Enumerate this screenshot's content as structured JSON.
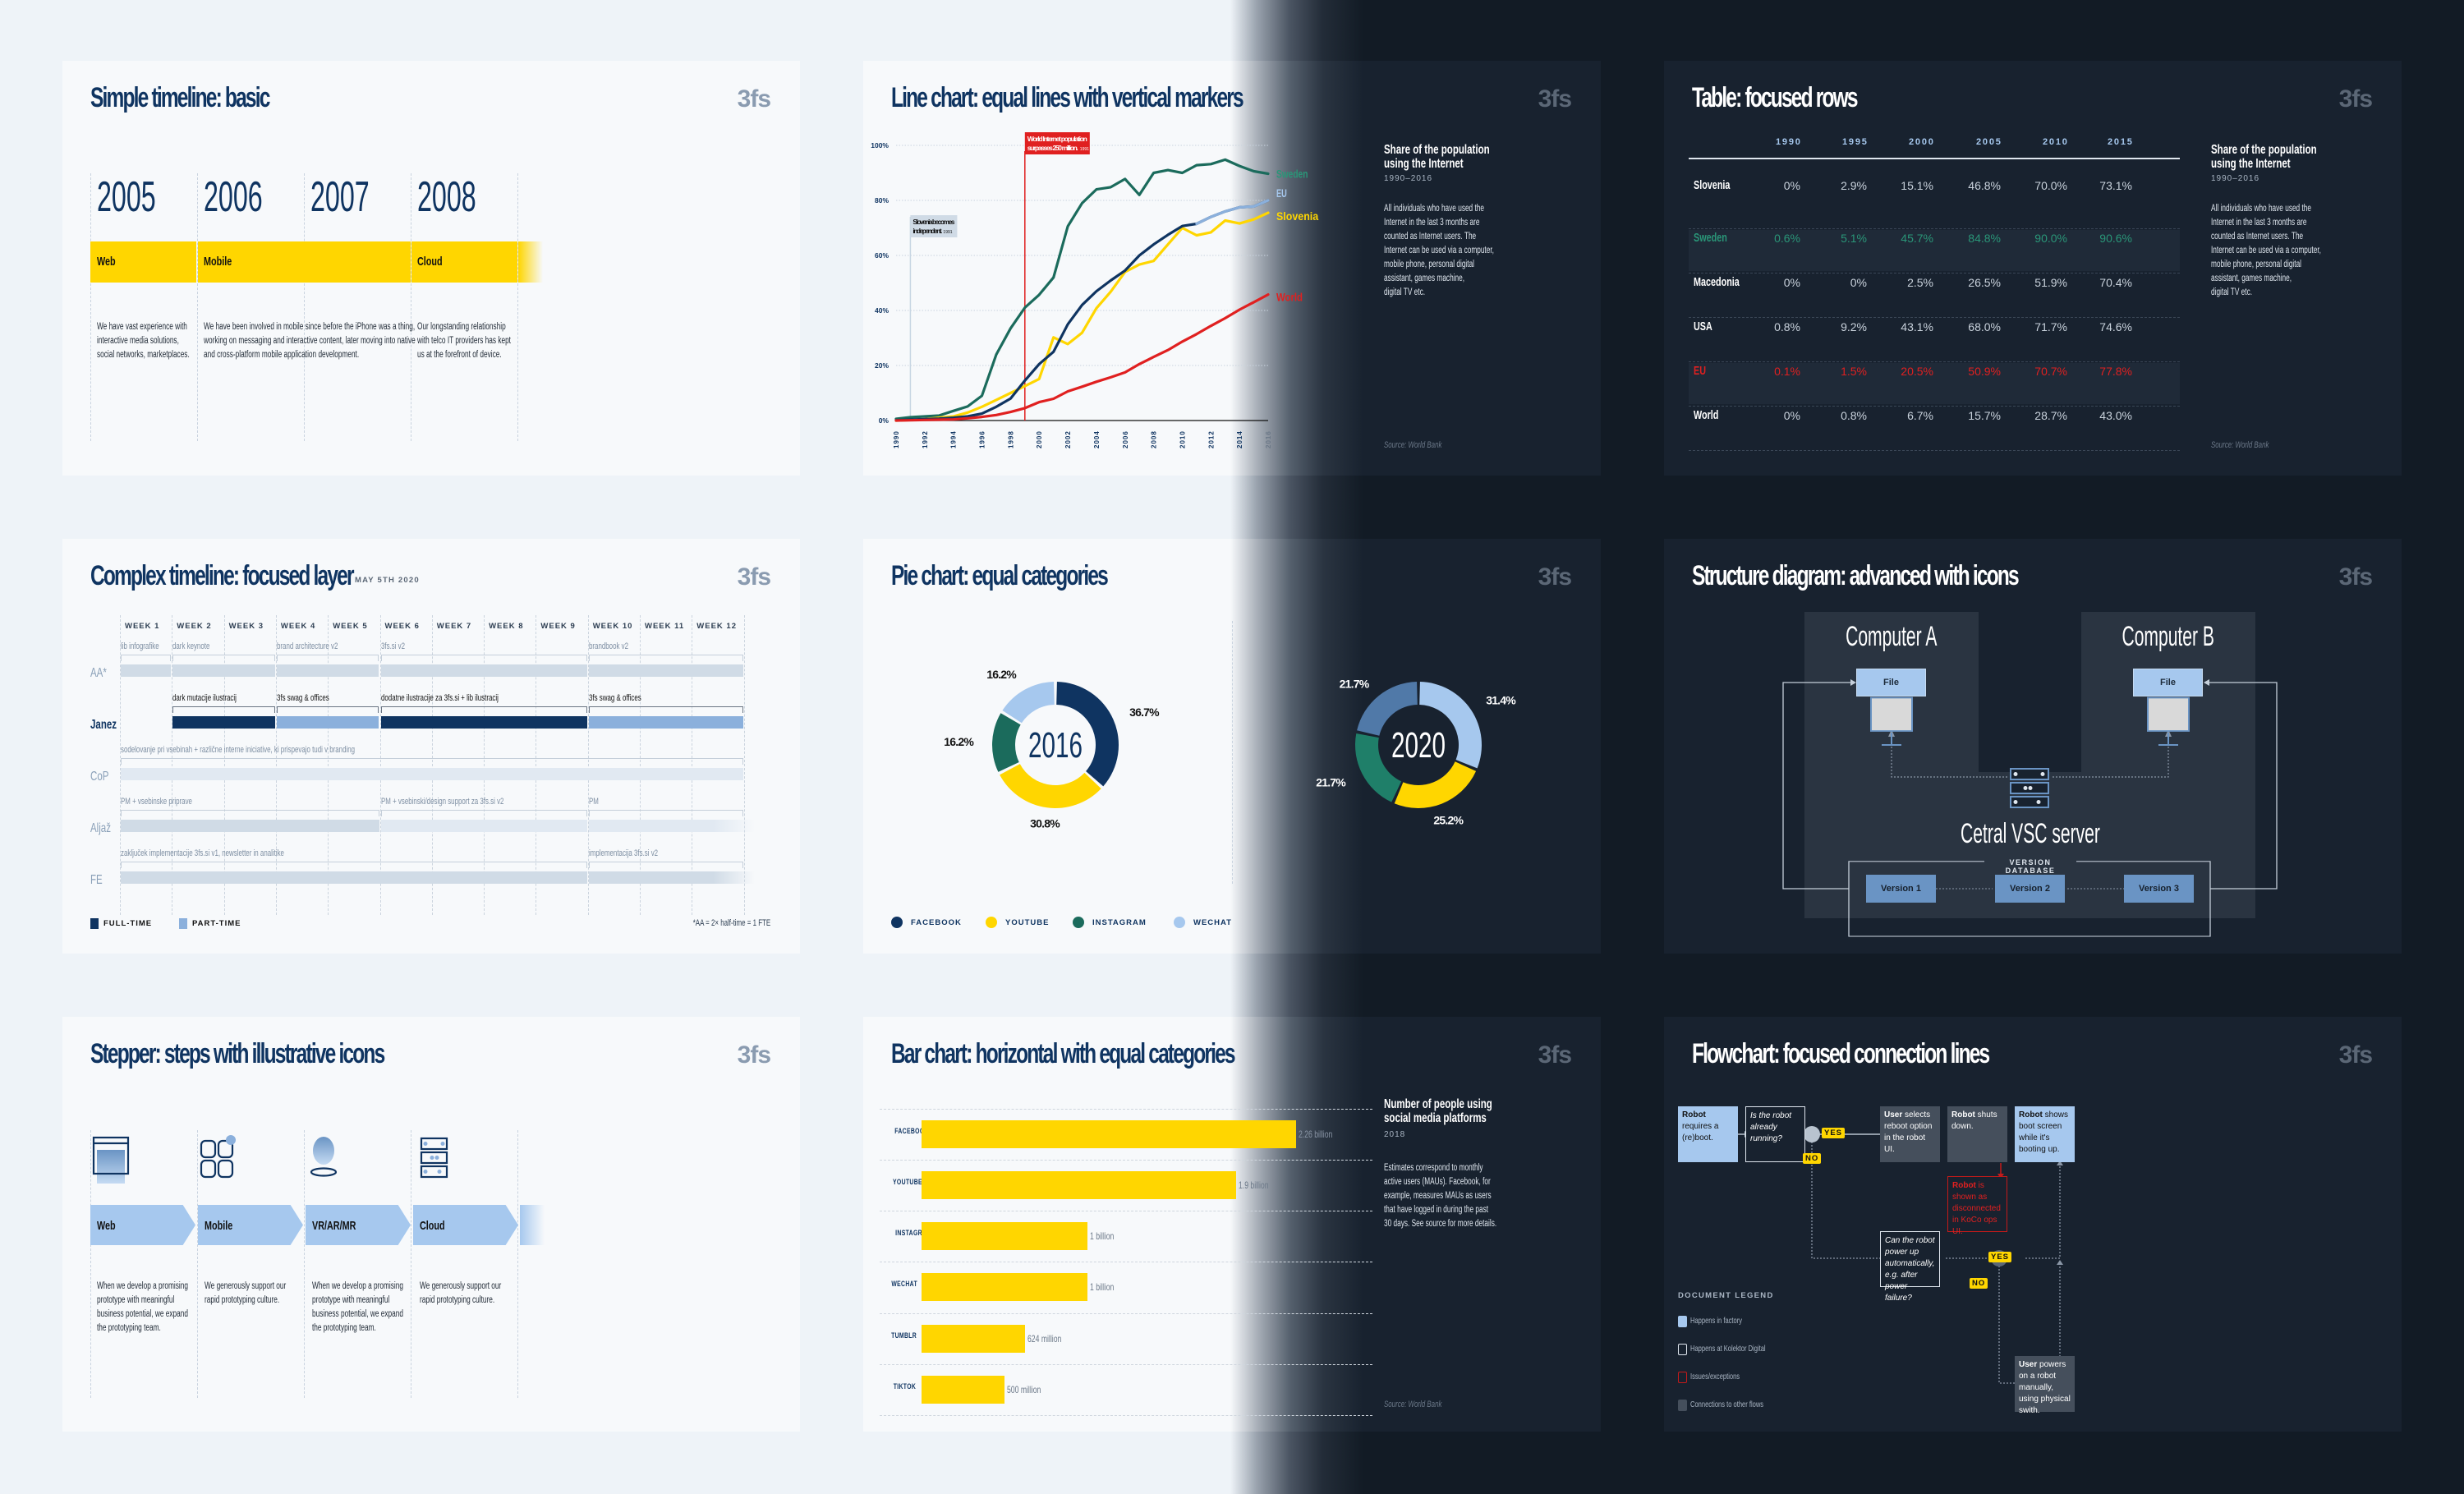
{
  "brand": "3fs",
  "colors": {
    "navy": "#0f3461",
    "yellow": "#ffd600",
    "light_blue": "#a6c8ee",
    "green": "#1b6b5c",
    "sweden_green": "#2a9678",
    "red": "#e02020",
    "steel_blue": "#5079a8",
    "dark_bg": "#121b25",
    "dark_card": "#18222f",
    "light_bg": "#eef3f8",
    "light_card": "#f7f9fb"
  },
  "simple_timeline": {
    "title": "Simple timeline: basic",
    "years": [
      "2005",
      "2006",
      "2007",
      "2008"
    ],
    "phases": [
      {
        "label": "Web",
        "desc": [
          "We have vast experience with",
          "interactive media solutions,",
          "social networks, marketplaces."
        ]
      },
      {
        "label": "Mobile",
        "desc": [
          "We have been involved in mobile since before the iPhone was a thing,",
          "working on messaging and interactive content, later moving into native",
          "and cross-platform mobile application development."
        ]
      },
      {
        "label": "Cloud",
        "desc": [
          "Our longstanding relationship",
          "with telco IT providers has kept",
          "us at the forefront of device."
        ]
      }
    ]
  },
  "line_chart": {
    "title": "Line chart: equal lines with vertical markers",
    "side_title": "Share of the population using the Internet",
    "side_title_lines": [
      "Share of the population",
      "using the Internet"
    ],
    "side_sub": "1990–2016",
    "side_desc": [
      "All individuals who have used the",
      "Internet in the last 3 months are",
      "counted as Internet users. The",
      "Internet can be used via a computer,",
      "mobile phone, personal digital",
      "assistant, games machine,",
      "digital TV etc."
    ],
    "source": "Source: World Bank",
    "annotations": [
      {
        "text_lines": [
          "Slovenia becomes",
          "independent."
        ],
        "year_tag": "1991",
        "x": 1991,
        "style": "light"
      },
      {
        "text_lines": [
          "World Internet population",
          "surpasses 250 million."
        ],
        "year_tag": "1991",
        "x": 1999,
        "style": "red"
      }
    ]
  },
  "chart_data": [
    {
      "type": "line",
      "title": "Share of the population using the Internet",
      "subtitle": "1990–2016",
      "xlabel": "",
      "ylabel": "",
      "x": [
        1990,
        1991,
        1992,
        1993,
        1994,
        1995,
        1996,
        1997,
        1998,
        1999,
        2000,
        2001,
        2002,
        2003,
        2004,
        2005,
        2006,
        2007,
        2008,
        2009,
        2010,
        2011,
        2012,
        2013,
        2014,
        2015,
        2016
      ],
      "x_ticks": [
        "1990",
        "1992",
        "1994",
        "1996",
        "1998",
        "2000",
        "2002",
        "2004",
        "2006",
        "2008",
        "2010",
        "2012",
        "2014",
        "2016"
      ],
      "y_ticks": [
        "0%",
        "20%",
        "40%",
        "60%",
        "80%",
        "100%"
      ],
      "ylim": [
        0,
        100
      ],
      "grid": true,
      "legend": "end-of-line labels",
      "series": [
        {
          "name": "Sweden",
          "color": "#1b6b5c",
          "label_color": "#2a9678",
          "values": [
            0.6,
            1.2,
            1.5,
            1.8,
            3.5,
            5.1,
            9,
            24,
            33.5,
            41,
            45.7,
            52,
            70.6,
            79,
            84,
            84.8,
            87.8,
            82,
            90,
            91,
            90,
            92.8,
            93.2,
            94.8,
            92.5,
            90.6,
            89.7
          ]
        },
        {
          "name": "EU",
          "color": "#0f3461",
          "label_color": "#a6c8ee",
          "values": [
            0.1,
            0.3,
            0.5,
            0.7,
            1,
            1.5,
            2.5,
            5,
            8,
            14.5,
            20.5,
            25,
            35,
            42,
            47,
            50.9,
            54.5,
            60,
            64,
            67.5,
            70.7,
            71.5,
            74,
            76,
            77.5,
            77.8,
            80
          ]
        },
        {
          "name": "Slovenia",
          "color": "#ffd600",
          "label_color": "#ffd600",
          "values": [
            0,
            0.2,
            0.5,
            1,
            1.5,
            2.9,
            5,
            7.5,
            10,
            12.5,
            15.1,
            30.2,
            27.8,
            31.9,
            40.8,
            46.8,
            54,
            56.7,
            58,
            64,
            70,
            67.3,
            68.4,
            72.7,
            71.6,
            73.1,
            75.5
          ]
        },
        {
          "name": "World",
          "color": "#e02020",
          "label_color": "#e02020",
          "values": [
            0,
            0.1,
            0.2,
            0.3,
            0.4,
            0.8,
            1.3,
            2,
            3.1,
            4.5,
            6.7,
            7.9,
            10.6,
            12.3,
            14.1,
            15.7,
            17.5,
            20.5,
            23.1,
            25.6,
            28.7,
            31.4,
            34.4,
            37.2,
            40.3,
            43,
            45.8
          ]
        }
      ]
    },
    {
      "type": "table",
      "title": "Share of the population using the Internet",
      "columns": [
        "",
        "1990",
        "1995",
        "2000",
        "2005",
        "2010",
        "2015"
      ],
      "rows": [
        {
          "name": "Slovenia",
          "values": [
            "0%",
            "2.9%",
            "15.1%",
            "46.8%",
            "70.0%",
            "73.1%"
          ],
          "style": "normal"
        },
        {
          "name": "Sweden",
          "values": [
            "0.6%",
            "5.1%",
            "45.7%",
            "84.8%",
            "90.0%",
            "90.6%"
          ],
          "style": "sweden"
        },
        {
          "name": "Macedonia",
          "values": [
            "0%",
            "0%",
            "2.5%",
            "26.5%",
            "51.9%",
            "70.4%"
          ],
          "style": "normal"
        },
        {
          "name": "USA",
          "values": [
            "0.8%",
            "9.2%",
            "43.1%",
            "68.0%",
            "71.7%",
            "74.6%"
          ],
          "style": "normal"
        },
        {
          "name": "EU",
          "values": [
            "0.1%",
            "1.5%",
            "20.5%",
            "50.9%",
            "70.7%",
            "77.8%"
          ],
          "style": "eu"
        },
        {
          "name": "World",
          "values": [
            "0%",
            "0.8%",
            "6.7%",
            "15.7%",
            "28.7%",
            "43.0%"
          ],
          "style": "normal"
        }
      ]
    },
    {
      "type": "pie",
      "title": "2016",
      "categories": [
        "Facebook",
        "YouTube",
        "Instagram",
        "WeChat"
      ],
      "values": [
        36.7,
        30.8,
        16.2,
        16.2
      ],
      "labels": [
        "36.7%",
        "30.8%",
        "16.2%",
        "16.2%"
      ],
      "colors": [
        "#0f3461",
        "#ffd600",
        "#1b6b5c",
        "#a6c8ee"
      ]
    },
    {
      "type": "pie",
      "title": "2020",
      "categories": [
        "WeChat",
        "YouTube",
        "Instagram",
        "Facebook"
      ],
      "values": [
        31.4,
        25.2,
        21.7,
        21.7
      ],
      "labels": [
        "31.4%",
        "25.2%",
        "21.7%",
        "21.7%"
      ],
      "colors": [
        "#a6c8ee",
        "#ffd600",
        "#1f7f69",
        "#5079a8"
      ]
    },
    {
      "type": "bar",
      "orientation": "horizontal",
      "title": "Number of people using social media platforms",
      "subtitle": "2018",
      "categories": [
        "FACEBOOK",
        "YOUTUBE",
        "INSTAGRAM",
        "WECHAT",
        "TUMBLR",
        "TIKTOK"
      ],
      "values": [
        2260,
        1900,
        1000,
        1000,
        624,
        500
      ],
      "unit": "million",
      "value_labels": [
        "2.26 billion",
        "1.9 billion",
        "1 billion",
        "1 billion",
        "624 million",
        "500 million"
      ],
      "xlim": [
        0,
        2260
      ],
      "grid": true
    }
  ],
  "table": {
    "title": "Table: focused rows",
    "side_title_lines": [
      "Share of the population",
      "using the Internet"
    ],
    "side_sub": "1990–2016",
    "side_desc": [
      "All individuals who have used the",
      "Internet in the last 3 months are",
      "counted as Internet users. The",
      "Internet can be used via a computer,",
      "mobile phone, personal digital",
      "assistant, games machine,",
      "digital TV etc."
    ],
    "source": "Source: World Bank"
  },
  "complex_timeline": {
    "title": "Complex timeline: focused layer",
    "date": "MAY 5TH 2020",
    "weeks": [
      "WEEK 1",
      "WEEK 2",
      "WEEK 3",
      "WEEK 4",
      "WEEK 5",
      "WEEK 6",
      "WEEK 7",
      "WEEK 8",
      "WEEK 9",
      "WEEK 10",
      "WEEK 11",
      "WEEK 12"
    ],
    "rows": [
      {
        "person": "AA*",
        "focus": false,
        "tasks": [
          {
            "label": "lib infografike",
            "start": 1,
            "end": 1,
            "type": "part"
          },
          {
            "label": "dark keynote",
            "start": 2,
            "end": 3,
            "type": "part"
          },
          {
            "label": "brand architecture v2",
            "start": 4,
            "end": 5,
            "type": "part"
          },
          {
            "label": "3fs.si v2",
            "start": 6,
            "end": 9,
            "type": "part"
          },
          {
            "label": "brandbook v2",
            "start": 10,
            "end": 12,
            "type": "part"
          }
        ]
      },
      {
        "person": "Janez",
        "focus": true,
        "tasks": [
          {
            "label": "dark mutacije ilustracij",
            "start": 2,
            "end": 3,
            "type": "full"
          },
          {
            "label": "3fs swag & offices",
            "start": 4,
            "end": 5,
            "type": "part"
          },
          {
            "label": "dodatne ilustracije za 3fs.si + lib ilustracij",
            "start": 6,
            "end": 9,
            "type": "full"
          },
          {
            "label": "3fs swag & offices",
            "start": 10,
            "end": 12,
            "type": "part"
          }
        ]
      },
      {
        "person": "CoP",
        "focus": false,
        "tasks": [
          {
            "label": "sodelovanje pri vsebinah + različne interne iniciative, ki prispevajo tudi v branding",
            "start": 1,
            "end": 12,
            "type": "light"
          }
        ]
      },
      {
        "person": "Aljaž",
        "focus": false,
        "tasks": [
          {
            "label": "PM + vsebinske priprave",
            "start": 1,
            "end": 5,
            "type": "part"
          },
          {
            "label": "PM + vsebinski/design support za 3fs.si v2",
            "start": 6,
            "end": 9,
            "type": "light"
          },
          {
            "label": "PM",
            "start": 10,
            "end": 12,
            "type": "light"
          }
        ]
      },
      {
        "person": "FE",
        "focus": false,
        "tasks": [
          {
            "label": "zaključek implementacije 3fs.si v1, newsletter in analitike",
            "start": 1,
            "end": 9,
            "type": "part"
          },
          {
            "label": "implementacija 3fs.si v2",
            "start": 10,
            "end": 12,
            "type": "part"
          }
        ]
      }
    ],
    "legend": [
      {
        "label": "FULL-TIME",
        "color": "#0f3461"
      },
      {
        "label": "PART-TIME",
        "color": "#8bb0dc"
      }
    ],
    "footnote": "*AA = 2× half-time = 1 FTE"
  },
  "pie": {
    "title": "Pie chart: equal categories",
    "legend": [
      {
        "label": "FACEBOOK",
        "color": "#0f3461"
      },
      {
        "label": "YOUTUBE",
        "color": "#ffd600"
      },
      {
        "label": "INSTAGRAM",
        "color": "#1b6b5c"
      },
      {
        "label": "WECHAT",
        "color": "#a6c8ee"
      }
    ]
  },
  "structure": {
    "title": "Structure diagram: advanced with icons",
    "computer_a": "Computer A",
    "computer_b": "Computer B",
    "file_label": "File",
    "server": "Cetral VSC server",
    "database": "VERSION DATABASE",
    "versions": [
      "Version 1",
      "Version 2",
      "Version 3"
    ]
  },
  "stepper": {
    "title": "Stepper: steps with illustrative icons",
    "steps": [
      {
        "label": "Web",
        "icon": "browser-window-icon",
        "desc": [
          "When we develop a promising",
          "prototype with meaningful",
          "business potential, we expand",
          "the prototyping team."
        ]
      },
      {
        "label": "Mobile",
        "icon": "app-grid-icon",
        "desc": [
          "We generously support our",
          "rapid prototyping culture."
        ]
      },
      {
        "label": "VR/AR/MR",
        "icon": "hologram-icon",
        "desc": [
          "When we develop a promising",
          "prototype with meaningful",
          "business potential, we expand",
          "the prototyping team."
        ]
      },
      {
        "label": "Cloud",
        "icon": "server-stack-icon",
        "desc": [
          "We generously support our",
          "rapid prototyping culture."
        ]
      }
    ]
  },
  "bar_chart": {
    "title": "Bar chart: horizontal with equal categories",
    "side_title_lines": [
      "Number of people using",
      "social media platforms"
    ],
    "side_sub": "2018",
    "side_desc": [
      "Estimates correspond to monthly",
      "active users (MAUs). Facebook, for",
      "example, measures MAUs as users",
      "that have logged in during the past",
      "30 days. See source for more details."
    ],
    "source": "Source: World Bank"
  },
  "flowchart": {
    "title": "Flowchart: focused connection lines",
    "nodes": {
      "start": {
        "bold": "Robot",
        "rest": " requires a (re)boot."
      },
      "q1": {
        "text": "Is the robot already running?"
      },
      "select": {
        "bold": "User",
        "rest": " selects reboot option in the robot UI."
      },
      "shutdown": {
        "bold": "Robot",
        "rest": " shuts down."
      },
      "boot": {
        "bold": "Robot",
        "rest": " shows boot screen while it's booting up."
      },
      "issue": {
        "bold": "Robot",
        "rest": " is shown as disconnected in KoCo ops UI."
      },
      "q2": {
        "text": "Can the robot power up automatically, e.g. after power failure?"
      },
      "manual": {
        "bold": "User",
        "rest": " powers on a robot manually, using physical swith."
      }
    },
    "yes": "YES",
    "no": "NO",
    "legend_title": "DOCUMENT LEGEND",
    "legend": [
      {
        "label": "Happens in factory",
        "style": "factory"
      },
      {
        "label": "Happens at Kolektor Digital",
        "style": "kolektor"
      },
      {
        "label": "Issues/exceptions",
        "style": "issue"
      },
      {
        "label": "Connections to other flows",
        "style": "other"
      }
    ]
  }
}
